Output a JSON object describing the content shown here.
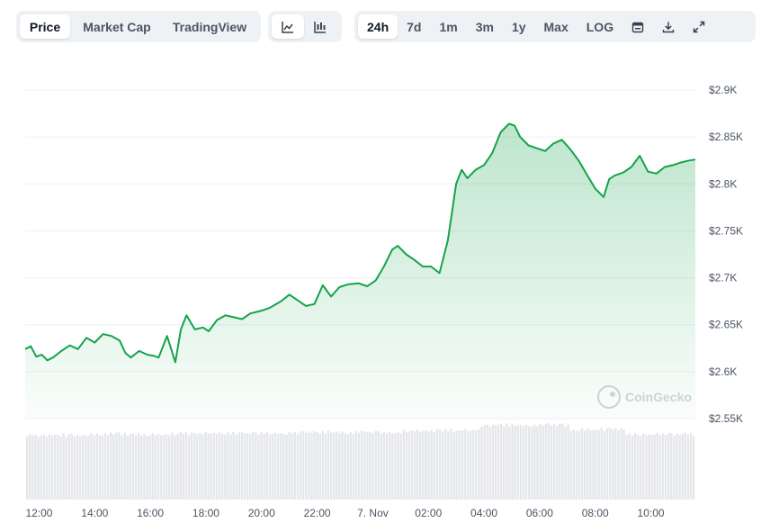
{
  "toolbar": {
    "chart_type_tabs": [
      "Price",
      "Market Cap",
      "TradingView"
    ],
    "active_type": "Price",
    "chart_style_buttons": [
      "line-chart-icon",
      "candlestick-chart-icon"
    ],
    "active_style": "line-chart-icon",
    "range_tabs": [
      "24h",
      "7d",
      "1m",
      "3m",
      "1y",
      "Max",
      "LOG"
    ],
    "active_range": "24h",
    "tool_icons": [
      "calendar-icon",
      "download-icon",
      "expand-icon"
    ]
  },
  "watermark": "CoinGecko",
  "colors": {
    "line": "#16a34a",
    "volume": "#e5e7eb",
    "grid": "#eef0f3",
    "text": "#4b5563"
  },
  "chart_data": {
    "type": "area",
    "title": "",
    "y_axis": {
      "ticks": [
        2550,
        2600,
        2650,
        2700,
        2750,
        2800,
        2850,
        2900
      ],
      "tick_labels": [
        "$2.55K",
        "$2.6K",
        "$2.65K",
        "$2.7K",
        "$2.75K",
        "$2.8K",
        "$2.85K",
        "$2.9K"
      ],
      "ylim": [
        2550,
        2900
      ]
    },
    "x_axis": {
      "tick_labels": [
        "12:00",
        "14:00",
        "16:00",
        "18:00",
        "20:00",
        "22:00",
        "7. Nov",
        "02:00",
        "04:00",
        "06:00",
        "08:00",
        "10:00"
      ],
      "tick_hours": [
        12,
        14,
        16,
        18,
        20,
        22,
        24,
        26,
        28,
        30,
        32,
        34
      ],
      "xlim_hours": [
        11.5,
        35.6
      ]
    },
    "price_series": {
      "hours": [
        11.5,
        11.7,
        11.9,
        12.1,
        12.3,
        12.5,
        12.8,
        13.1,
        13.4,
        13.7,
        14.0,
        14.3,
        14.6,
        14.9,
        15.1,
        15.3,
        15.6,
        15.9,
        16.1,
        16.3,
        16.6,
        16.9,
        17.1,
        17.3,
        17.6,
        17.9,
        18.1,
        18.4,
        18.7,
        19.0,
        19.3,
        19.6,
        20.0,
        20.3,
        20.7,
        21.0,
        21.3,
        21.6,
        21.9,
        22.2,
        22.5,
        22.8,
        23.1,
        23.5,
        23.8,
        24.1,
        24.4,
        24.7,
        24.9,
        25.2,
        25.5,
        25.8,
        26.1,
        26.4,
        26.7,
        27.0,
        27.2,
        27.4,
        27.7,
        28.0,
        28.3,
        28.6,
        28.9,
        29.1,
        29.3,
        29.6,
        29.9,
        30.2,
        30.5,
        30.8,
        31.1,
        31.4,
        31.7,
        32.0,
        32.3,
        32.5,
        32.7,
        33.0,
        33.3,
        33.6,
        33.9,
        34.2,
        34.5,
        34.8,
        35.1,
        35.4,
        35.6
      ],
      "values": [
        2624,
        2627,
        2616,
        2618,
        2612,
        2615,
        2622,
        2628,
        2624,
        2636,
        2631,
        2640,
        2638,
        2633,
        2620,
        2615,
        2622,
        2618,
        2617,
        2615,
        2638,
        2610,
        2645,
        2660,
        2645,
        2647,
        2643,
        2655,
        2660,
        2658,
        2656,
        2662,
        2665,
        2668,
        2675,
        2682,
        2676,
        2670,
        2672,
        2692,
        2680,
        2690,
        2693,
        2694,
        2691,
        2697,
        2712,
        2730,
        2734,
        2725,
        2719,
        2712,
        2712,
        2705,
        2740,
        2800,
        2815,
        2806,
        2815,
        2820,
        2833,
        2855,
        2864,
        2862,
        2850,
        2841,
        2838,
        2835,
        2843,
        2847,
        2837,
        2825,
        2810,
        2795,
        2786,
        2805,
        2809,
        2812,
        2818,
        2830,
        2813,
        2811,
        2818,
        2820,
        2823,
        2825,
        2826
      ]
    },
    "volume_series": {
      "note_units": "relative",
      "start_hour": 11.5,
      "end_hour": 35.6,
      "segments": [
        {
          "from": 11.5,
          "to": 14.0,
          "level": 0.69
        },
        {
          "from": 14.0,
          "to": 17.0,
          "level": 0.7
        },
        {
          "from": 17.0,
          "to": 21.0,
          "level": 0.71
        },
        {
          "from": 21.0,
          "to": 25.0,
          "level": 0.72
        },
        {
          "from": 25.0,
          "to": 27.8,
          "level": 0.74
        },
        {
          "from": 27.8,
          "to": 31.0,
          "level": 0.8
        },
        {
          "from": 31.0,
          "to": 33.0,
          "level": 0.75
        },
        {
          "from": 33.0,
          "to": 35.6,
          "level": 0.7
        }
      ]
    }
  }
}
